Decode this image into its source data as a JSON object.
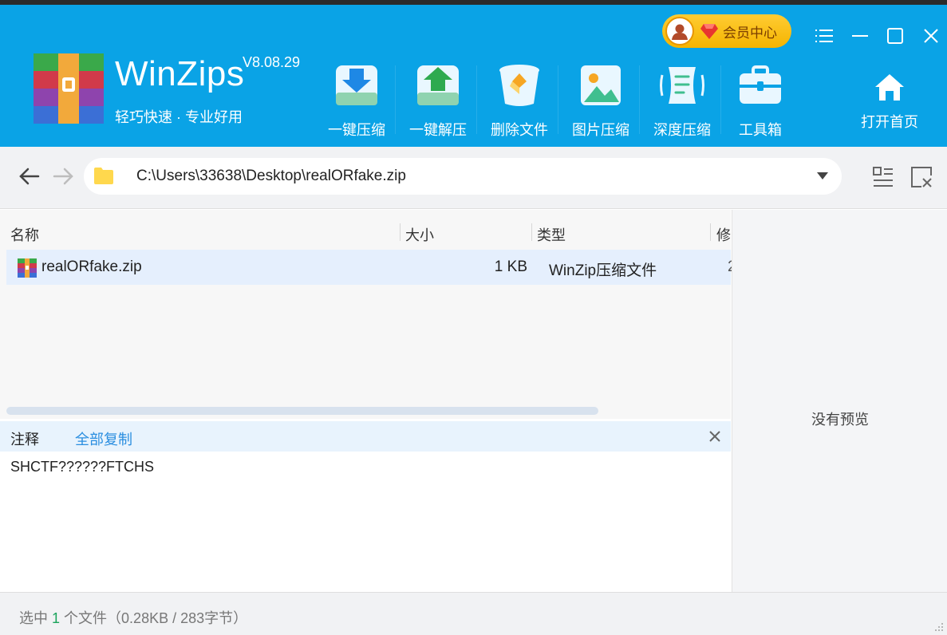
{
  "app": {
    "name": "WinZips",
    "version": "V8.08.29",
    "slogan": "轻巧快速 · 专业好用"
  },
  "vip": {
    "label": "会员中心"
  },
  "toolbar": {
    "items": [
      {
        "label": "一键压缩",
        "icon": "compress-icon"
      },
      {
        "label": "一键解压",
        "icon": "extract-icon"
      },
      {
        "label": "删除文件",
        "icon": "delete-file-icon"
      },
      {
        "label": "图片压缩",
        "icon": "image-compress-icon"
      },
      {
        "label": "深度压缩",
        "icon": "deep-compress-icon"
      },
      {
        "label": "工具箱",
        "icon": "toolbox-icon"
      }
    ],
    "home_label": "打开首页"
  },
  "address": {
    "path": "C:\\Users\\33638\\Desktop\\realORfake.zip"
  },
  "list": {
    "columns": [
      "名称",
      "大小",
      "类型",
      "修"
    ],
    "rows": [
      {
        "name": "realORfake.zip",
        "size": "1 KB",
        "type": "WinZip压缩文件",
        "modified": "2"
      }
    ]
  },
  "comment": {
    "title": "注释",
    "copy_all": "全部复制",
    "text": "SHCTF??????FTCHS"
  },
  "preview": {
    "empty_text": "没有预览"
  },
  "status": {
    "prefix": "选中",
    "count": "1",
    "suffix": "个文件（0.28KB / 283字节）"
  },
  "colors": {
    "header_bg": "#0aa3e6",
    "vip_gold": "#ffcc33",
    "accent_link": "#2a8ee0",
    "status_num": "#1aa35b"
  }
}
